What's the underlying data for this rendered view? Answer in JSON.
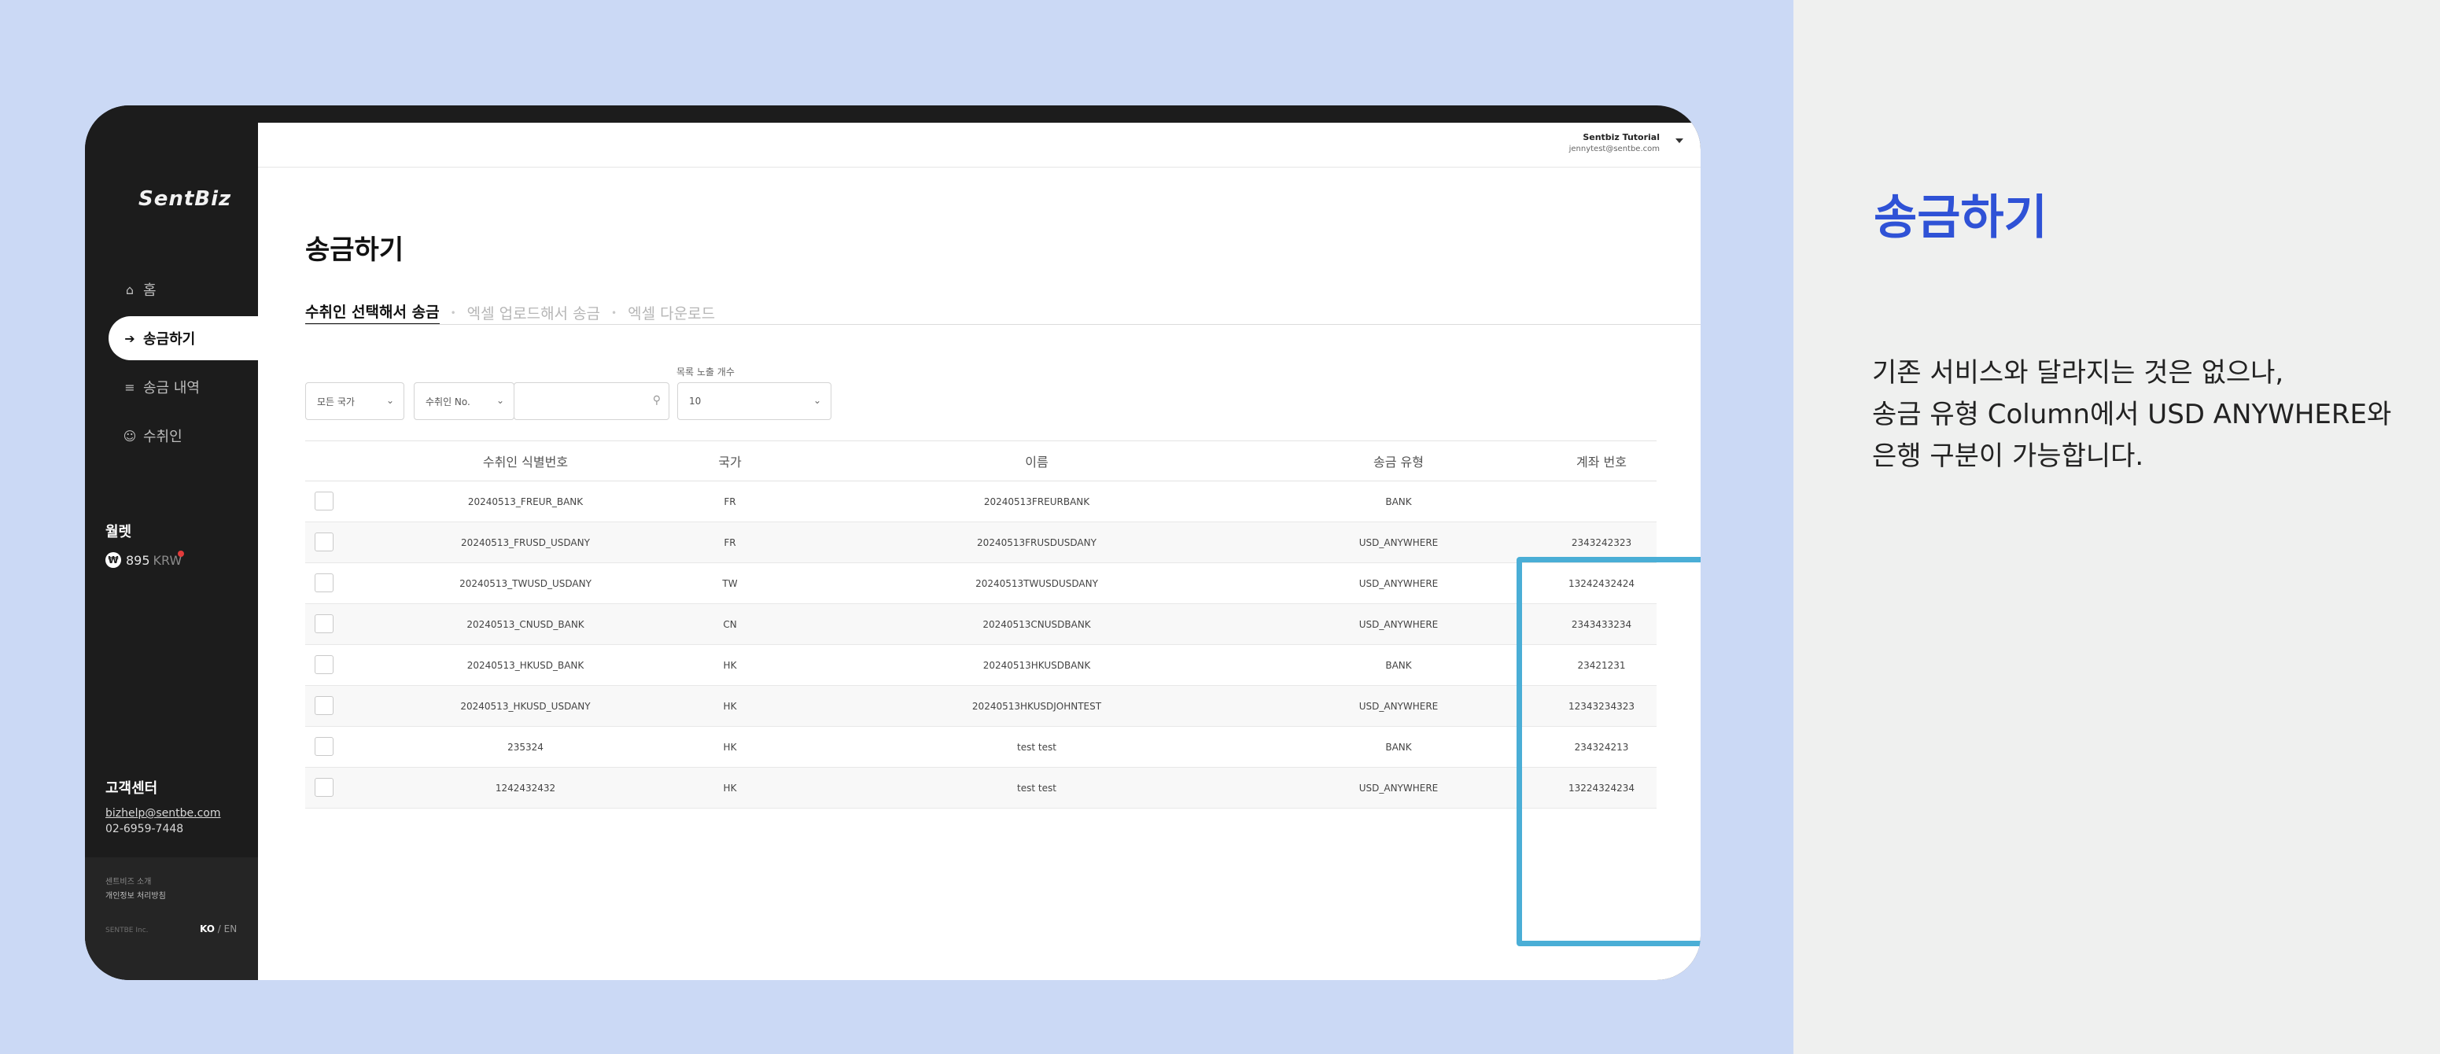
{
  "app": {
    "logo": "SentBiz",
    "nav": [
      {
        "icon": "⌂",
        "label": "홈"
      },
      {
        "icon": "➔",
        "label": "송금하기"
      },
      {
        "icon": "≡",
        "label": "송금 내역"
      },
      {
        "icon": "☺",
        "label": "수취인"
      }
    ],
    "wallet": {
      "title": "월렛",
      "coin": "₩",
      "amount": "895",
      "unit": "KRW"
    },
    "support": {
      "title": "고객센터",
      "email": "bizhelp@sentbe.com",
      "phone": "02-6959-7448"
    },
    "footer": {
      "link1": "센트비즈 소개",
      "link2": "개인정보 처리방침",
      "copyright": "SENTBE Inc.",
      "lang_active": "KO",
      "lang_sep": "/",
      "lang_other": "EN"
    }
  },
  "account": {
    "name": "Sentbiz Tutorial",
    "email": "jennytest@sentbe.com"
  },
  "page": {
    "title": "송금하기",
    "tabs": [
      "수취인 선택해서 송금",
      "엑셀 업로드해서 송금",
      "엑셀 다운로드"
    ],
    "tab_sep": "•"
  },
  "filters": {
    "country": "모든 국가",
    "field": "수취인 No.",
    "search_value": "",
    "page_size_label": "목록 노출 개수",
    "page_size": "10",
    "chevron": "⌄",
    "search_icon": "⚲"
  },
  "table": {
    "headers": [
      "수취인 식별번호",
      "국가",
      "이름",
      "송금 유형",
      "계좌 번호"
    ],
    "rows": [
      {
        "id": "20240513_FREUR_BANK",
        "country": "FR",
        "name": "20240513FREURBANK",
        "type": "BANK",
        "account": ""
      },
      {
        "id": "20240513_FRUSD_USDANY",
        "country": "FR",
        "name": "20240513FRUSDUSDANY",
        "type": "USD_ANYWHERE",
        "account": "2343242323"
      },
      {
        "id": "20240513_TWUSD_USDANY",
        "country": "TW",
        "name": "20240513TWUSDUSDANY",
        "type": "USD_ANYWHERE",
        "account": "13242432424"
      },
      {
        "id": "20240513_CNUSD_BANK",
        "country": "CN",
        "name": "20240513CNUSDBANK",
        "type": "USD_ANYWHERE",
        "account": "2343433234"
      },
      {
        "id": "20240513_HKUSD_BANK",
        "country": "HK",
        "name": "20240513HKUSDBANK",
        "type": "BANK",
        "account": "23421231"
      },
      {
        "id": "20240513_HKUSD_USDANY",
        "country": "HK",
        "name": "20240513HKUSDJOHNTEST",
        "type": "USD_ANYWHERE",
        "account": "12343234323"
      },
      {
        "id": "235324",
        "country": "HK",
        "name": "test test",
        "type": "BANK",
        "account": "234324213"
      },
      {
        "id": "1242432432",
        "country": "HK",
        "name": "test test",
        "type": "USD_ANYWHERE",
        "account": "13224324234"
      }
    ]
  },
  "side_panel": {
    "title": "송금하기",
    "lines": [
      "기존 서비스와 달라지는 것은 없으나,",
      "송금 유형 Column에서 USD ANYWHERE와",
      "은행 구분이 가능합니다."
    ]
  },
  "colors": {
    "accent": "#2f52d6",
    "highlight": "#4aaed6",
    "sidebar": "#1c1c1c",
    "background": "#cbd9f5"
  }
}
